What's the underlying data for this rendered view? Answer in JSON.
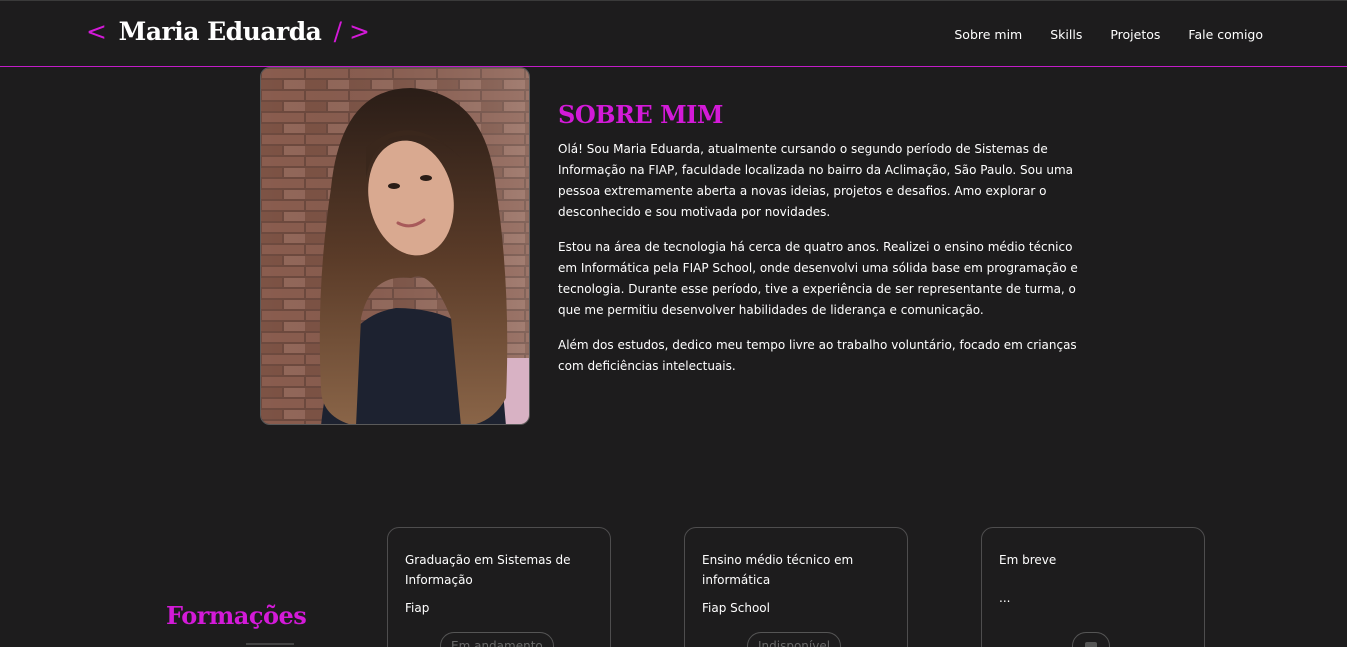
{
  "header": {
    "logo_open": "<",
    "logo_name": "Maria Eduarda",
    "logo_close": "/ >",
    "nav": [
      "Sobre mim",
      "Skills",
      "Projetos",
      "Fale comigo"
    ]
  },
  "about": {
    "title": "SOBRE MIM",
    "paragraphs": [
      "Olá! Sou Maria Eduarda, atualmente cursando o segundo período de Sistemas de Informação na FIAP, faculdade localizada no bairro da Aclimação, São Paulo. Sou uma pessoa extremamente aberta a novas ideias, projetos e desafios. Amo explorar o desconhecido e sou motivada por novidades.",
      "Estou na área de tecnologia há cerca de quatro anos. Realizei o ensino médio técnico em Informática pela FIAP School, onde desenvolvi uma sólida base em programação e tecnologia. Durante esse período, tive a experiência de ser representante de turma, o que me permitiu desenvolver habilidades de liderança e comunicação.",
      "Além dos estudos, dedico meu tempo livre ao trabalho voluntário, focado em crianças com deficiências intelectuais."
    ]
  },
  "formacoes": {
    "title": "Formações",
    "cards": [
      {
        "title": "Graduação em Sistemas de Informação",
        "school": "Fiap",
        "badge": "Em andamento"
      },
      {
        "title": "Ensino médio técnico em informática",
        "school": "Fiap School",
        "badge": "Indisponível"
      },
      {
        "title": "Em breve",
        "school": "...",
        "badge": ""
      }
    ]
  },
  "colors": {
    "accent": "#d31ad8",
    "background": "#1d1c1d",
    "text": "#ffffff"
  }
}
